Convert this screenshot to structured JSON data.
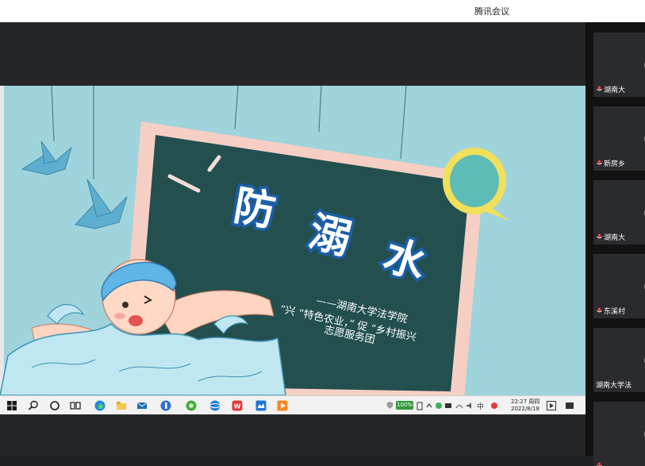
{
  "window": {
    "title": "腾讯会议"
  },
  "slide": {
    "title_chars": [
      "防",
      "溺",
      "水"
    ],
    "line1": "——湖南大学法学院",
    "line2": "“兴 “特色农业，” 促 “乡村振兴",
    "line3": "志愿服务团"
  },
  "participants": [
    {
      "name": "湖南大",
      "mic": true
    },
    {
      "name": "新房乡",
      "mic": true
    },
    {
      "name": "湖南大",
      "mic": true
    },
    {
      "name": "东溪村",
      "mic": true
    },
    {
      "name": "湖南大学法",
      "mic": false
    },
    {
      "name": "",
      "mic": true
    }
  ],
  "taskbar": {
    "pinned_icons": [
      "start-icon",
      "search-icon",
      "cortana-icon",
      "task-view-icon",
      "edge-icon",
      "file-explorer-icon",
      "mail-icon",
      "app-blue-icon",
      "browser-green-icon",
      "browser-blue-icon",
      "wps-icon",
      "meeting-app-icon",
      "video-app-icon"
    ],
    "battery": "100%",
    "time": "22:27 周四",
    "date": "2022/8/18"
  }
}
